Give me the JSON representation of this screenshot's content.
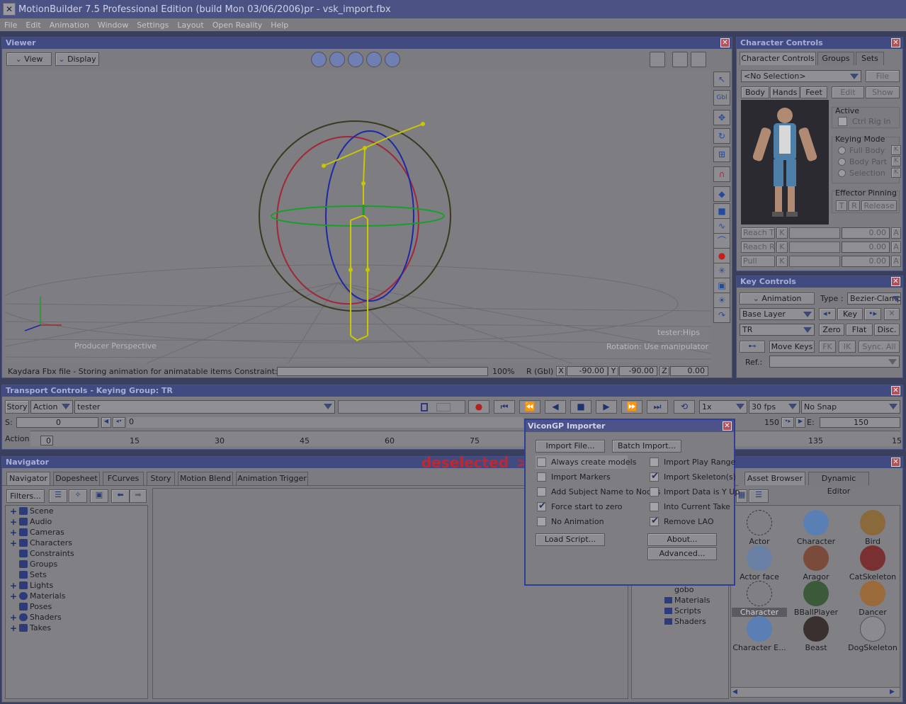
{
  "window": {
    "title": "MotionBuilder 7.5 Professional Edition (build Mon 03/06/2006)pr - vsk_import.fbx"
  },
  "menu": [
    "File",
    "Edit",
    "Animation",
    "Window",
    "Settings",
    "Layout",
    "Open Reality",
    "Help"
  ],
  "viewer": {
    "title": "Viewer",
    "view_btn": "View",
    "display_btn": "Display",
    "camera_label": "Producer Perspective",
    "hint_object": "tester:Hips",
    "hint_manip": "Rotation: Use manipulator",
    "status_text": "Kaydara Fbx file - Storing animation for animatable items Constraint::Characte",
    "progress": "100%",
    "rot_label": "R (Gbl)",
    "x_label": "X",
    "x_val": "-90.00",
    "y_label": "Y",
    "y_val": "-90.00",
    "z_label": "Z",
    "z_val": "0.00",
    "gbl": "Gbl"
  },
  "character_controls": {
    "title": "Character Controls",
    "tabs": [
      "Character Controls",
      "Groups",
      "Sets"
    ],
    "selection": "<No Selection>",
    "file_btn": "File",
    "body_btn": "Body",
    "hands_btn": "Hands",
    "feet_btn": "Feet",
    "edit_btn": "Edit",
    "show_btn": "Show",
    "active_label": "Active",
    "ctrl_rig_in": "Ctrl Rig In",
    "keying_mode": "Keying Mode",
    "full_body": "Full Body",
    "body_part": "Body Part",
    "selection_opt": "Selection",
    "k": "K",
    "effector_pinning": "Effector Pinning",
    "t_btn": "T",
    "r_btn": "R",
    "release_btn": "Release",
    "reach_t": "Reach T",
    "reach_r": "Reach R",
    "pull": "Pull",
    "reach_t_val": "0.00",
    "reach_r_val": "0.00",
    "pull_val": "0.00",
    "a": "A"
  },
  "key_controls": {
    "title": "Key Controls",
    "animation": "Animation",
    "type_label": "Type :",
    "type_value": "Bezier-Clamp",
    "base_layer": "Base Layer",
    "key_btn": "Key",
    "tr": "TR",
    "zero_btn": "Zero",
    "flat_btn": "Flat",
    "disc_btn": "Disc.",
    "move_keys": "Move Keys",
    "fk_btn": "FK",
    "ik_btn": "IK",
    "sync_btn": "Sync. All",
    "ref_label": "Ref.:"
  },
  "transport": {
    "title": "Transport Controls  -  Keying Group: TR",
    "story_btn": "Story",
    "action": "Action",
    "take": "tester",
    "speed": "1x",
    "fps": "30 fps",
    "snap": "No Snap",
    "s_label": "S:",
    "s_val": "0",
    "current": "0",
    "end_frame": "150",
    "e_label": "E:",
    "e_val": "150",
    "action_label": "Action",
    "ticks": [
      "0",
      "15",
      "30",
      "45",
      "60",
      "75",
      "135",
      "15"
    ]
  },
  "navigator": {
    "title": "Navigator",
    "annotation": "deselected",
    "annotation_arrow": ">",
    "tabs": [
      "Navigator",
      "Dopesheet",
      "FCurves",
      "Story",
      "Motion Blend",
      "Animation Trigger"
    ],
    "filters_btn": "Filters...",
    "tree": [
      "Scene",
      "Audio",
      "Cameras",
      "Characters",
      "Constraints",
      "Groups",
      "Sets",
      "Lights",
      "Materials",
      "Poses",
      "Shaders",
      "Takes"
    ],
    "folder_tree": [
      "gobo",
      "Materials",
      "Scripts",
      "Shaders"
    ]
  },
  "asset_browser": {
    "tabs": [
      "Asset Browser",
      "Dynamic Editor"
    ],
    "assets": [
      "Actor",
      "Character face",
      "Bird",
      "Actor face",
      "Aragor",
      "CatSkeleton",
      "Character",
      "BBallPlayer",
      "Dancer",
      "Character E...",
      "Beast",
      "DogSkeleton"
    ]
  },
  "dialog": {
    "title": "ViconGP Importer",
    "import_file": "Import File...",
    "batch_import": "Batch Import...",
    "left_options": [
      {
        "label": "Always create models",
        "checked": false
      },
      {
        "label": "Import Markers",
        "checked": false
      },
      {
        "label": "Add Subject Name to Nodes",
        "checked": false
      },
      {
        "label": "Force start to zero",
        "checked": true
      },
      {
        "label": "No Animation",
        "checked": false
      }
    ],
    "right_options": [
      {
        "label": "Import Play Range",
        "checked": false
      },
      {
        "label": "Import Skeleton(s)",
        "checked": true
      },
      {
        "label": "Import Data is Y Up",
        "checked": false
      },
      {
        "label": "Into Current Take",
        "checked": false
      },
      {
        "label": "Remove LAO",
        "checked": true
      }
    ],
    "load_script": "Load Script...",
    "about": "About...",
    "advanced": "Advanced..."
  },
  "colors": {
    "title_bar": "#4a5283",
    "panel": "#7b7b80",
    "annotation": "#c0282c",
    "dialog_border": "#2c3d9c"
  }
}
